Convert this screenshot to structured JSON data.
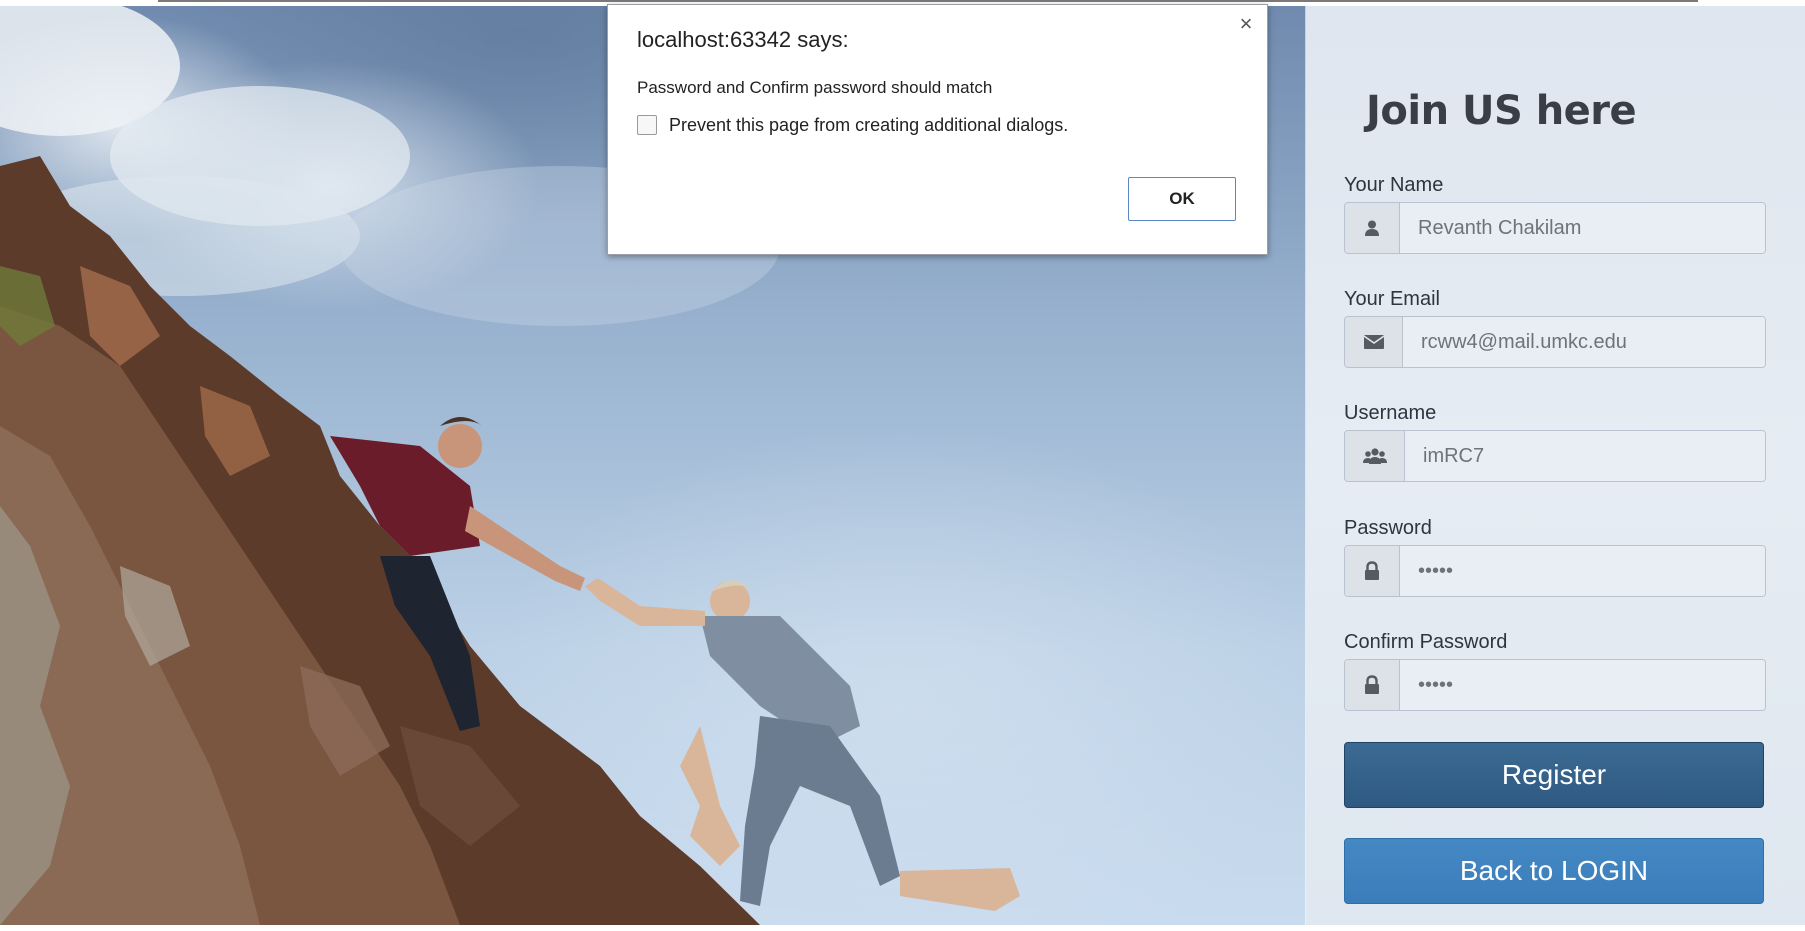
{
  "dialog": {
    "title": "localhost:63342 says:",
    "message": "Password and Confirm password should match",
    "checkbox_label": "Prevent this page from creating additional dialogs.",
    "ok_label": "OK",
    "close_glyph": "×"
  },
  "form": {
    "heading": "Join US here",
    "fields": [
      {
        "label": "Your Name",
        "value": "Revanth Chakilam",
        "icon": "user-icon"
      },
      {
        "label": "Your Email",
        "value": "rcww4@mail.umkc.edu",
        "icon": "envelope-icon"
      },
      {
        "label": "Username",
        "value": "imRC7",
        "icon": "users-icon"
      },
      {
        "label": "Password",
        "value": "•••••",
        "icon": "lock-icon"
      },
      {
        "label": "Confirm Password",
        "value": "•••••",
        "icon": "lock-icon"
      }
    ],
    "register_label": "Register",
    "back_label": "Back to LOGIN"
  },
  "colors": {
    "register_button": "#2e5a82",
    "login_button": "#3a7dba",
    "panel_background": "#e3e9f0"
  }
}
